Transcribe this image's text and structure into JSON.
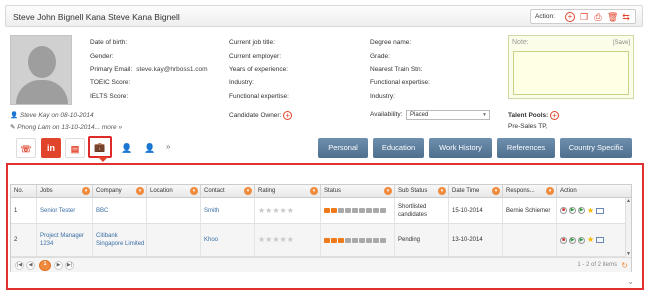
{
  "candidate": {
    "name": "Steve John Bignell Kana Steve Kana Bignell"
  },
  "actions": {
    "label": "Action:",
    "icons": [
      "plus-icon",
      "copy-icon",
      "print-icon",
      "delete-icon",
      "transfer-icon"
    ]
  },
  "meta": {
    "created": "Steve Kay on 08-10-2014",
    "modified": "Phong Lam on 13-10-2014... more »"
  },
  "col1": [
    {
      "label": "Date of birth:",
      "value": ""
    },
    {
      "label": "Gender:",
      "value": ""
    },
    {
      "label": "Primary Email:",
      "value": "steve.kay@hrboss1.com"
    },
    {
      "label": "TOEIC Score:",
      "value": ""
    },
    {
      "label": "IELTS Score:",
      "value": ""
    }
  ],
  "col2": [
    {
      "label": "Current job title:",
      "value": ""
    },
    {
      "label": "Current employer:",
      "value": ""
    },
    {
      "label": "Years of experience:",
      "value": ""
    },
    {
      "label": "Industry:",
      "value": ""
    },
    {
      "label": "Functional expertise:",
      "value": ""
    }
  ],
  "col3": [
    {
      "label": "Degree name:",
      "value": ""
    },
    {
      "label": "Grade:",
      "value": ""
    },
    {
      "label": "Nearest Train Stn:",
      "value": ""
    },
    {
      "label": "Functional expertise:",
      "value": ""
    },
    {
      "label": "Industry:",
      "value": ""
    }
  ],
  "candidate_owner": {
    "label": "Candidate Owner:"
  },
  "availability": {
    "label": "Availability:",
    "value": "Placed"
  },
  "talent_pools": {
    "label": "Talent Pools:",
    "value": "Pre-Sales TP,"
  },
  "note": {
    "label": "Note:",
    "save": "[Save]"
  },
  "tabs": [
    "Personal",
    "Education",
    "Work History",
    "References",
    "Country Specific"
  ],
  "tiles": [
    "contact-card-icon",
    "linkedin-icon",
    "document-icon",
    "briefcase-icon",
    "person-orange-icon",
    "person-blue-icon"
  ],
  "tile_text": {
    "linkedin": "in"
  },
  "grid": {
    "columns": [
      "No.",
      "Jobs",
      "Company",
      "Location",
      "Contact",
      "Rating",
      "Status",
      "Sub Status",
      "Date Time",
      "Respons...",
      "Action"
    ],
    "rows": [
      {
        "no": "1",
        "job": "Senior Tester",
        "company": "BBC",
        "location": "",
        "contact": "Smith",
        "status_done": 2,
        "status_total": 9,
        "sub_status": "Shortlisted candidates",
        "date": "15-10-2014",
        "responsible": "Bernie Schiemer"
      },
      {
        "no": "2",
        "job": "Project Manager 1234",
        "company": "Citibank Singapore Limited",
        "location": "",
        "contact": "Khoo",
        "status_done": 3,
        "status_total": 9,
        "sub_status": "Pending",
        "date": "13-10-2014",
        "responsible": ""
      }
    ],
    "pager": {
      "current": "1",
      "info": "1 - 2 of 2 items"
    }
  },
  "colors": {
    "accent": "#e0452c",
    "tab": "#5a7a9a",
    "status_on": "#f07a1a",
    "highlight": "#e03030"
  }
}
